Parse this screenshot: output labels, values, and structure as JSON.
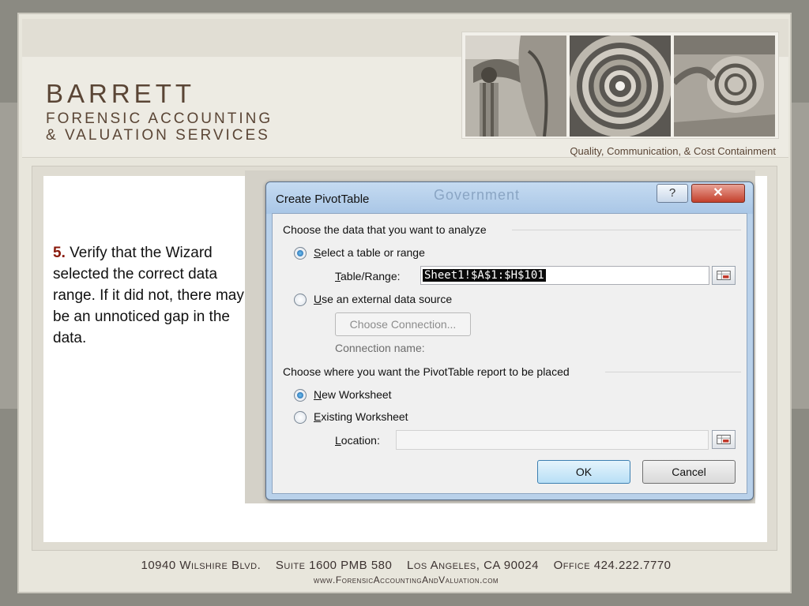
{
  "brand": {
    "name": "BARRETT",
    "line1": "FORENSIC ACCOUNTING",
    "line2": "& VALUATION SERVICES",
    "tagline": "Quality, Communication, & Cost Containment",
    "color": "#5a4535"
  },
  "instruction": {
    "step": "5.",
    "text": " Verify that the Wizard selected the correct data range.  If it did not, there may be an unnoticed gap in the data."
  },
  "dialog": {
    "title": "Create PivotTable",
    "background_text": "Government",
    "help_icon": "question-mark-icon",
    "close_icon": "close-x-icon",
    "group1": {
      "label": "Choose the data that you want to analyze",
      "option_table": "Select a table or range",
      "table_range_label": "Table/Range:",
      "table_range_value": "Sheet1!$A$1:$H$101",
      "option_external": "Use an external data source",
      "choose_connection": "Choose Connection...",
      "connection_name_label": "Connection name:"
    },
    "group2": {
      "label": "Choose where you want the PivotTable report to be placed",
      "option_new": "New Worksheet",
      "option_existing": "Existing Worksheet",
      "location_label": "Location:",
      "location_value": ""
    },
    "ok": "OK",
    "cancel": "Cancel",
    "selected_data_option": "Select a table or range",
    "selected_place_option": "New Worksheet"
  },
  "footer": {
    "address": "10940 Wilshire Blvd.    Suite 1600 PMB 580    Los Angeles, CA 90024    Office 424.222.7770",
    "url": "www.ForensicAccountingAndValuation.com"
  }
}
